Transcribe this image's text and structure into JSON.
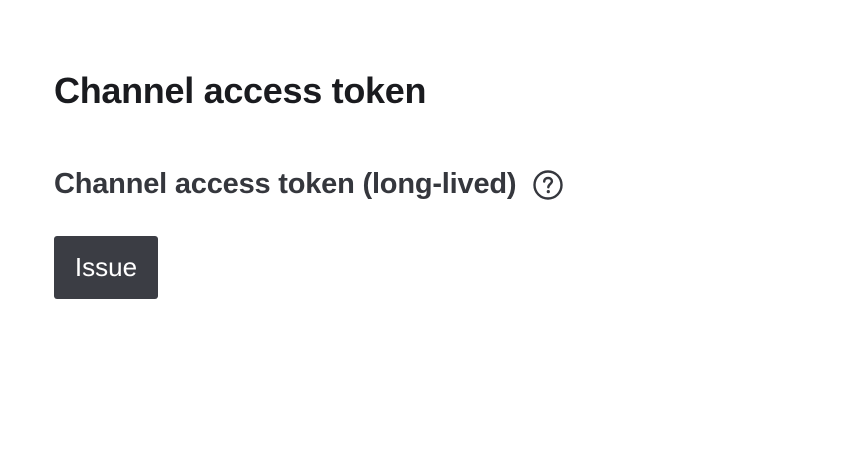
{
  "section": {
    "title": "Channel access token"
  },
  "long_lived": {
    "label": "Channel access token (long-lived)",
    "help_icon": "question-circle-icon"
  },
  "actions": {
    "issue_label": "Issue"
  },
  "colors": {
    "button_background": "#3b3d44",
    "button_text": "#ffffff",
    "title_text": "#1a1b1f",
    "subtitle_text": "#35373d"
  }
}
